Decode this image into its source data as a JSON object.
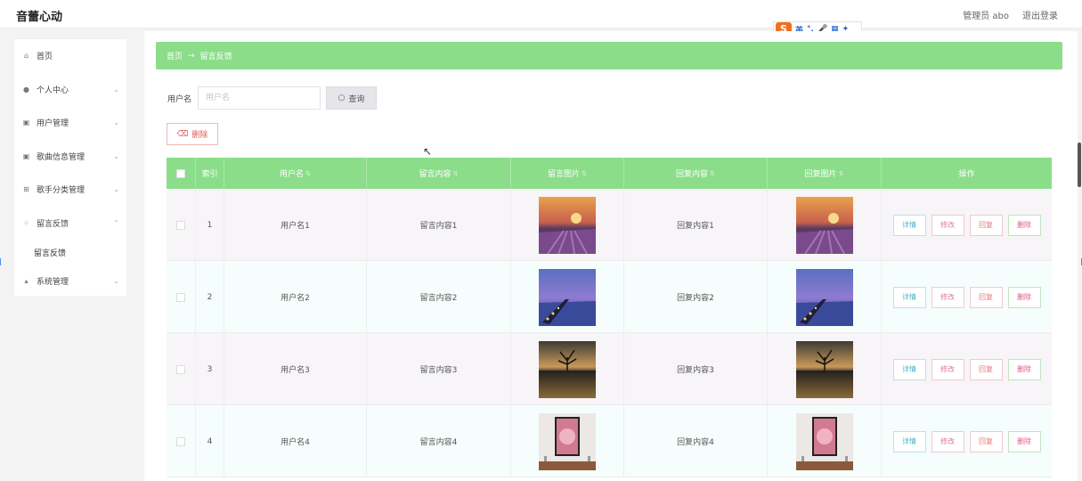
{
  "app_title": "音蕾心动",
  "header": {
    "user_label": "管理员 abo",
    "logout": "退出登录"
  },
  "ime": {
    "logo": "S",
    "items": [
      "英",
      "°,",
      "🎤",
      "▦",
      "✦"
    ]
  },
  "sidebar": {
    "items": [
      {
        "label": "首页",
        "icon": "home-icon",
        "expandable": false
      },
      {
        "label": "个人中心",
        "icon": "user-icon",
        "expandable": true
      },
      {
        "label": "用户管理",
        "icon": "lock-icon",
        "expandable": true
      },
      {
        "label": "歌曲信息管理",
        "icon": "lock-icon",
        "expandable": true
      },
      {
        "label": "歌手分类管理",
        "icon": "tag-icon",
        "expandable": true
      },
      {
        "label": "留言反馈",
        "icon": "grid-icon",
        "expandable": true
      },
      {
        "label": "系统管理",
        "icon": "chart-icon",
        "expandable": true
      }
    ],
    "active_sub": "留言反馈"
  },
  "breadcrumb": {
    "home": "首页",
    "arrow": "→",
    "current": "留言反馈"
  },
  "search": {
    "label": "用户名",
    "placeholder": "用户名",
    "value": "",
    "button": "查询"
  },
  "toolbar": {
    "delete_label": "删除"
  },
  "table": {
    "columns": [
      "索引",
      "用户名",
      "留言内容",
      "留言图片",
      "回复内容",
      "回复图片",
      "操作"
    ],
    "actions": [
      "详情",
      "修改",
      "回复",
      "删除"
    ],
    "rows": [
      {
        "index": "1",
        "username": "用户名1",
        "content": "留言内容1",
        "reply": "回复内容1",
        "image": "lavender-sunset"
      },
      {
        "index": "2",
        "username": "用户名2",
        "content": "留言内容2",
        "reply": "回复内容2",
        "image": "pier-dusk"
      },
      {
        "index": "3",
        "username": "用户名3",
        "content": "留言内容3",
        "reply": "回复内容3",
        "image": "lone-tree-lake"
      },
      {
        "index": "4",
        "username": "用户名4",
        "content": "留言内容4",
        "reply": "回复内容4",
        "image": "framed-portrait"
      }
    ]
  },
  "colors": {
    "accent_green": "#8bdd8a",
    "danger": "#e05858"
  }
}
